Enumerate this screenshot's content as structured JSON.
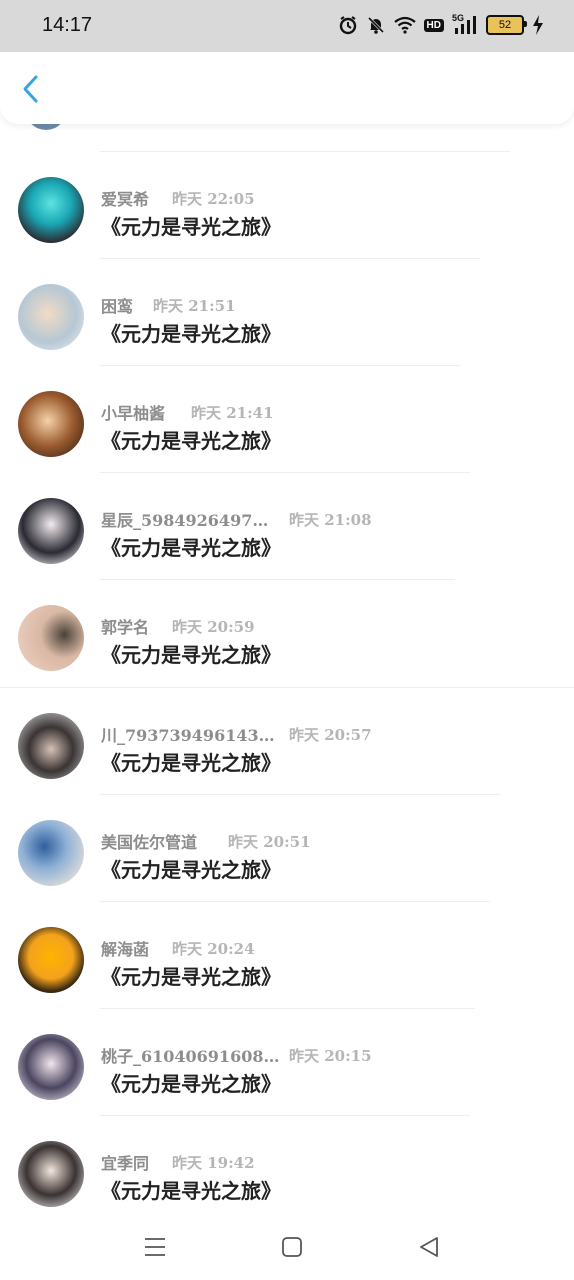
{
  "status_bar": {
    "time": "14:17",
    "signal_label": "5G",
    "hd_label": "HD",
    "battery_level": "52",
    "icons": [
      "alarm-icon",
      "mute-icon",
      "wifi-icon",
      "hd-icon",
      "signal-icon",
      "battery-icon",
      "charging-icon"
    ]
  },
  "header": {
    "back_icon": "chevron-left-icon",
    "accent_color": "#3aa3dd"
  },
  "messages": [
    {
      "name": "爱冥希",
      "time": "昨天 22:05",
      "text": "《元力是寻光之旅》"
    },
    {
      "name": "困鸾",
      "time": "昨天 21:51",
      "text": "《元力是寻光之旅》"
    },
    {
      "name": "小早柚酱",
      "time": "昨天 21:41",
      "text": "《元力是寻光之旅》"
    },
    {
      "name": "星辰_5984926497…",
      "time": "昨天 21:08",
      "text": "《元力是寻光之旅》"
    },
    {
      "name": "郭学名",
      "time": "昨天 20:59",
      "text": "《元力是寻光之旅》"
    },
    {
      "name": "川_793739496143…",
      "time": "昨天 20:57",
      "text": "《元力是寻光之旅》"
    },
    {
      "name": "美国佐尔管道",
      "time": "昨天 20:51",
      "text": "《元力是寻光之旅》"
    },
    {
      "name": "解海菡",
      "time": "昨天 20:24",
      "text": "《元力是寻光之旅》"
    },
    {
      "name": "桃子_61040691608…",
      "time": "昨天 20:15",
      "text": "《元力是寻光之旅》"
    },
    {
      "name": "宜季同",
      "time": "昨天 19:42",
      "text": "《元力是寻光之旅》"
    }
  ],
  "nav_bar": {
    "icons": [
      "menu-icon",
      "home-icon",
      "back-triangle-icon"
    ]
  }
}
